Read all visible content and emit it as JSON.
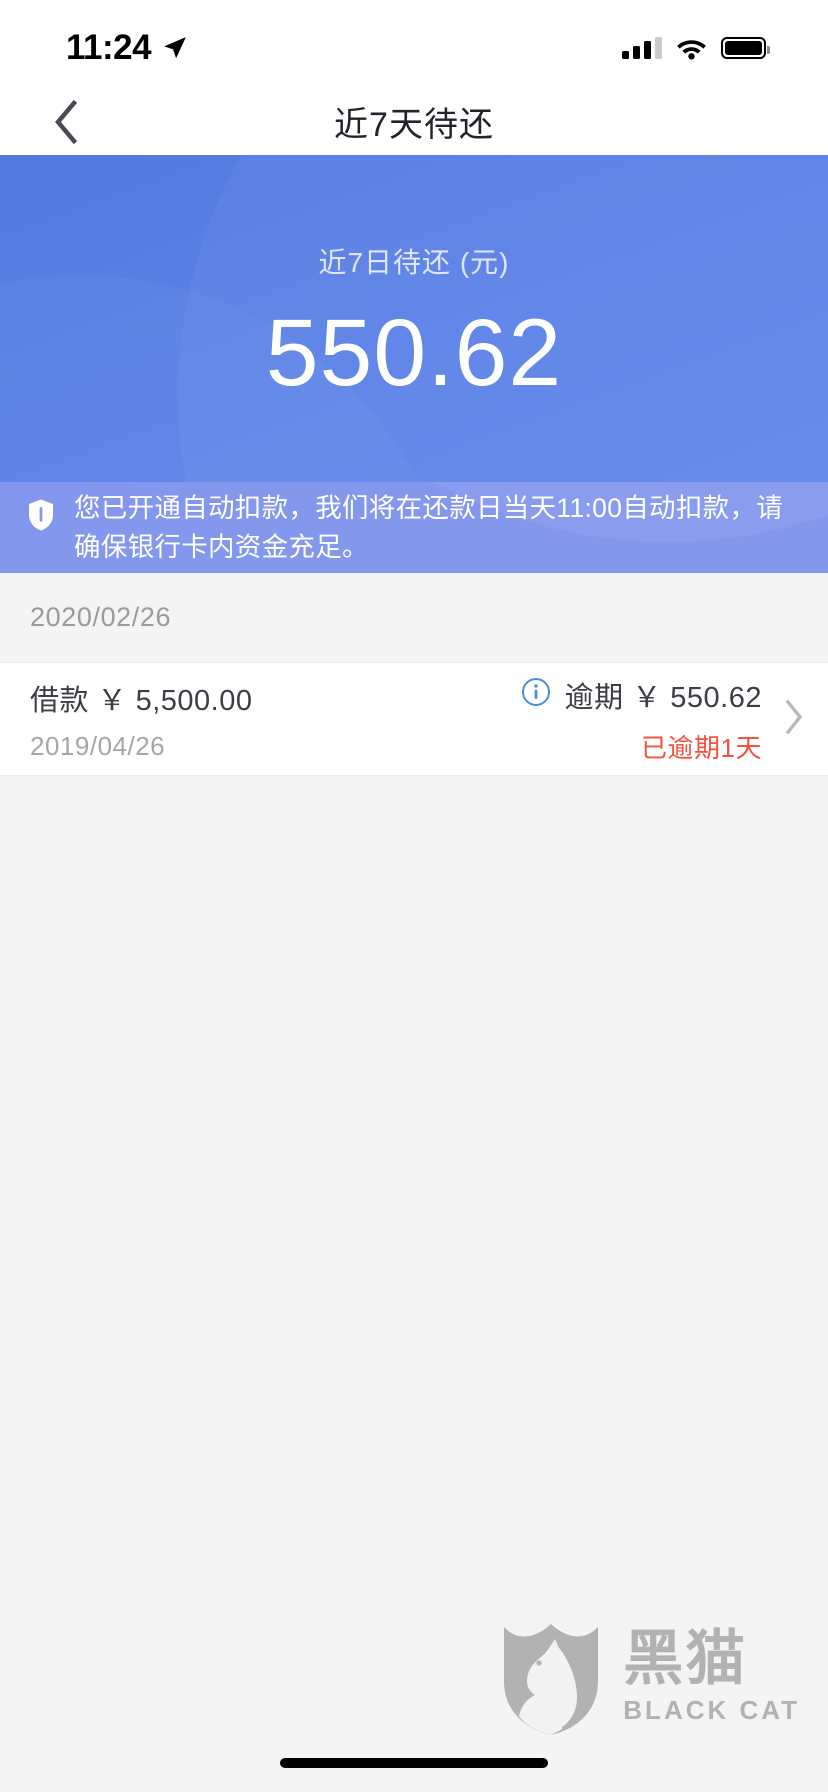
{
  "status_bar": {
    "time": "11:24",
    "location_icon": "location-arrow-icon",
    "signal_icon": "cellular-signal-icon",
    "wifi_icon": "wifi-icon",
    "battery_icon": "battery-full-icon"
  },
  "nav": {
    "back_icon": "chevron-left-icon",
    "title": "近7天待还"
  },
  "hero": {
    "label": "近7日待还 (元)",
    "amount": "550.62",
    "bg_color": "#5a81e6"
  },
  "notice": {
    "icon": "shield-icon",
    "text": "您已开通自动扣款，我们将在还款日当天11:00自动扣款，请确保银行卡内资金充足。",
    "bg_color": "#8397ec"
  },
  "section": {
    "date": "2020/02/26"
  },
  "item": {
    "title": "借款 ￥ 5,500.00",
    "date": "2019/04/26",
    "info_icon": "info-circle-icon",
    "status_amount": "逾期 ￥ 550.62",
    "overdue_text": "已逾期1天",
    "overdue_color": "#f4533c",
    "chevron_icon": "chevron-right-icon"
  },
  "watermark": {
    "name_cn": "黑猫",
    "name_en": "BLACK CAT",
    "logo_icon": "black-cat-shield-logo"
  }
}
